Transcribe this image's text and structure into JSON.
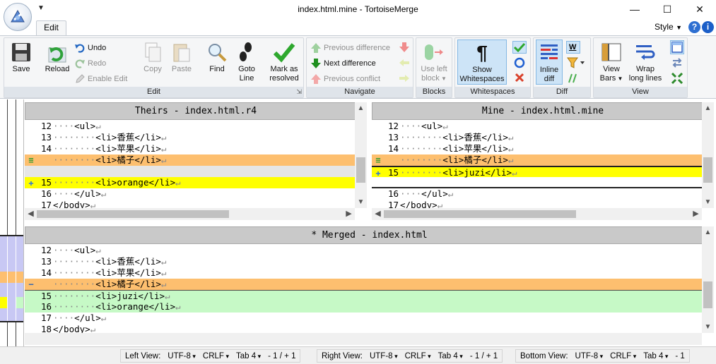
{
  "window": {
    "title": "index.html.mine - TortoiseMerge",
    "minimize": "—",
    "maximize": "☐",
    "close": "✕"
  },
  "ribbon": {
    "tab_edit": "Edit",
    "style_menu": "Style",
    "groups": {
      "edit": {
        "label": "Edit",
        "save": "Save",
        "reload": "Reload",
        "undo": "Undo",
        "redo": "Redo",
        "enable_edit": "Enable Edit",
        "copy": "Copy",
        "paste": "Paste",
        "find": "Find",
        "goto_line": [
          "Goto",
          "Line"
        ],
        "mark_resolved": [
          "Mark as",
          "resolved"
        ]
      },
      "navigate": {
        "label": "Navigate",
        "prev_diff": "Previous difference",
        "next_diff": "Next difference",
        "prev_conflict": "Previous conflict"
      },
      "blocks": {
        "label": "Blocks",
        "use_left_block": [
          "Use left",
          "block"
        ]
      },
      "whitespaces": {
        "label": "Whitespaces",
        "show_whitespaces": [
          "Show",
          "Whitespaces"
        ]
      },
      "diff": {
        "label": "Diff",
        "inline_diff": [
          "Inline",
          "diff"
        ]
      },
      "view": {
        "label": "View",
        "view_bars": [
          "View",
          "Bars"
        ],
        "wrap_long_lines": [
          "Wrap",
          "long lines"
        ]
      }
    }
  },
  "panes": {
    "theirs": {
      "header": "Theirs - index.html.r4",
      "lines": [
        {
          "num": "12",
          "ws": "····",
          "text": "<ul>",
          "eol": "↵",
          "bg": "",
          "marker": ""
        },
        {
          "num": "13",
          "ws": "········",
          "text": "<li>香蕉</li>",
          "eol": "↵",
          "bg": "",
          "marker": ""
        },
        {
          "num": "14",
          "ws": "········",
          "text": "<li>苹果</li>",
          "eol": "↵",
          "bg": "",
          "marker": ""
        },
        {
          "num": "",
          "ws": "········",
          "text": "<li>橘子</li>",
          "eol": "↵",
          "bg": "orange",
          "marker": "equal"
        },
        {
          "num": "",
          "ws": "",
          "text": "",
          "eol": "",
          "bg": "gray",
          "marker": ""
        },
        {
          "num": "15",
          "ws": "········",
          "text": "<li>orange</li>",
          "eol": "↵",
          "bg": "yellow",
          "marker": "plus"
        },
        {
          "num": "16",
          "ws": "····",
          "text": "</ul>",
          "eol": "↵",
          "bg": "",
          "marker": ""
        },
        {
          "num": "17",
          "ws": "",
          "text": "</body>",
          "eol": "↵",
          "bg": "",
          "marker": ""
        }
      ]
    },
    "mine": {
      "header": "Mine - index.html.mine",
      "lines": [
        {
          "num": "12",
          "ws": "····",
          "text": "<ul>",
          "eol": "↵",
          "bg": "",
          "marker": ""
        },
        {
          "num": "13",
          "ws": "········",
          "text": "<li>香蕉</li>",
          "eol": "↵",
          "bg": "",
          "marker": ""
        },
        {
          "num": "14",
          "ws": "········",
          "text": "<li>苹果</li>",
          "eol": "↵",
          "bg": "",
          "marker": ""
        },
        {
          "num": "",
          "ws": "········",
          "text": "<li>橘子</li>",
          "eol": "↵",
          "bg": "orange",
          "marker": "equal"
        },
        {
          "num": "15",
          "ws": "········",
          "text": "<li>juzi</li>",
          "eol": "↵",
          "bg": "yellow",
          "marker": "plus"
        },
        {
          "num": "",
          "ws": "",
          "text": "",
          "eol": "",
          "bg": "",
          "marker": ""
        },
        {
          "num": "16",
          "ws": "····",
          "text": "</ul>",
          "eol": "↵",
          "bg": "",
          "marker": ""
        },
        {
          "num": "17",
          "ws": "",
          "text": "</body>",
          "eol": "↵",
          "bg": "",
          "marker": ""
        }
      ]
    },
    "merged": {
      "header": "* Merged - index.html",
      "lines": [
        {
          "num": "12",
          "ws": "····",
          "text": "<ul>",
          "eol": "↵",
          "bg": "",
          "marker": ""
        },
        {
          "num": "13",
          "ws": "········",
          "text": "<li>香蕉</li>",
          "eol": "↵",
          "bg": "",
          "marker": ""
        },
        {
          "num": "14",
          "ws": "········",
          "text": "<li>苹果</li>",
          "eol": "↵",
          "bg": "",
          "marker": ""
        },
        {
          "num": "",
          "ws": "········",
          "text": "<li>橘子</li>",
          "eol": "↵",
          "bg": "orange",
          "marker": "minus"
        },
        {
          "num": "15",
          "ws": "········",
          "text": "<li>juzi</li>",
          "eol": "↵",
          "bg": "green",
          "marker": ""
        },
        {
          "num": "16",
          "ws": "········",
          "text": "<li>orange</li>",
          "eol": "↵",
          "bg": "green",
          "marker": ""
        },
        {
          "num": "17",
          "ws": "····",
          "text": "</ul>",
          "eol": "↵",
          "bg": "",
          "marker": ""
        },
        {
          "num": "18",
          "ws": "",
          "text": "</body>",
          "eol": "↵",
          "bg": "",
          "marker": ""
        }
      ]
    }
  },
  "statusbar": {
    "left_view": {
      "label": "Left View:",
      "encoding": "UTF-8",
      "eol": "CRLF",
      "tab": "Tab 4",
      "pos": "- 1 / + 1"
    },
    "right_view": {
      "label": "Right View:",
      "encoding": "UTF-8",
      "eol": "CRLF",
      "tab": "Tab 4",
      "pos": "- 1 / + 1"
    },
    "bottom_view": {
      "label": "Bottom View:",
      "encoding": "UTF-8",
      "eol": "CRLF",
      "tab": "Tab 4",
      "pos": "- 1"
    }
  },
  "colors": {
    "conflict_orange": "#fdbf6f",
    "added_yellow": "#ffff00",
    "merged_green": "#c6f9c6",
    "header_gray": "#c9c9c9"
  }
}
